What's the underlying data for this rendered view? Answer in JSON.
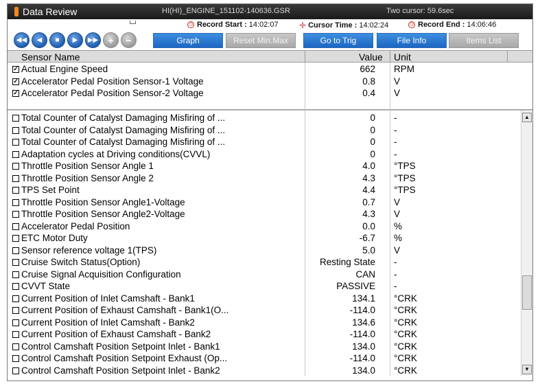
{
  "titlebar": {
    "app_title": "Data Review",
    "file_name": "HI(HI)_ENGINE_151102-140636.GSR",
    "cursor_info": "Two cursor: 59.6sec"
  },
  "timebar": {
    "record_start_label": "Record Start :",
    "record_start": "14:02:07",
    "cursor_time_label": "Cursor Time :",
    "cursor_time": "14:02:24",
    "record_end_label": "Record End :",
    "record_end": "14:06:46"
  },
  "toolbar": {
    "nav": [
      "first-icon",
      "prev-icon",
      "stop-icon",
      "play-icon",
      "last-icon",
      "plus-icon",
      "minus-icon"
    ],
    "buttons": [
      "Graph",
      "Reset Min.Max",
      "Go to Trig",
      "File Info",
      "Items List"
    ]
  },
  "columns": {
    "name": "Sensor Name",
    "value": "Value",
    "unit": "Unit"
  },
  "fixed_rows": [
    {
      "name": "Actual Engine Speed",
      "value": "662",
      "unit": "RPM"
    },
    {
      "name": "Accelerator Pedal Position Sensor-1 Voltage",
      "value": "0.8",
      "unit": "V"
    },
    {
      "name": "Accelerator Pedal Position Sensor-2 Voltage",
      "value": "0.4",
      "unit": "V"
    }
  ],
  "rows": [
    {
      "name": "Total Counter of Catalyst Damaging Misfiring of ...",
      "value": "0",
      "unit": "-"
    },
    {
      "name": "Total Counter of Catalyst Damaging Misfiring of ...",
      "value": "0",
      "unit": "-"
    },
    {
      "name": "Total Counter of Catalyst Damaging Misfiring of ...",
      "value": "0",
      "unit": "-"
    },
    {
      "name": "Adaptation cycles at Driving conditions(CVVL)",
      "value": "0",
      "unit": "-"
    },
    {
      "name": "Throttle Position Sensor Angle 1",
      "value": "4.0",
      "unit": "°TPS"
    },
    {
      "name": "Throttle Position Sensor Angle 2",
      "value": "4.3",
      "unit": "°TPS"
    },
    {
      "name": "TPS Set Point",
      "value": "4.4",
      "unit": "°TPS"
    },
    {
      "name": "Throttle Position Sensor Angle1-Voltage",
      "value": "0.7",
      "unit": "V"
    },
    {
      "name": "Throttle Position Sensor Angle2-Voltage",
      "value": "4.3",
      "unit": "V"
    },
    {
      "name": "Accelerator Pedal Position",
      "value": "0.0",
      "unit": "%"
    },
    {
      "name": "ETC Motor Duty",
      "value": "-6.7",
      "unit": "%"
    },
    {
      "name": "Sensor reference voltage 1(TPS)",
      "value": "5.0",
      "unit": "V"
    },
    {
      "name": "Cruise Switch Status(Option)",
      "value": "Resting State",
      "unit": "-"
    },
    {
      "name": "Cruise Signal Acquisition Configuration",
      "value": "CAN",
      "unit": "-"
    },
    {
      "name": "CVVT State",
      "value": "PASSIVE",
      "unit": "-"
    },
    {
      "name": "Current Position of Inlet Camshaft - Bank1",
      "value": "134.1",
      "unit": "°CRK"
    },
    {
      "name": "Current Position of Exhaust Camshaft - Bank1(O...",
      "value": "-114.0",
      "unit": "°CRK"
    },
    {
      "name": "Current Position of Inlet Camshaft - Bank2",
      "value": "134.6",
      "unit": "°CRK"
    },
    {
      "name": "Current Position of Exhaust Camshaft - Bank2",
      "value": "-114.0",
      "unit": "°CRK"
    },
    {
      "name": "Control Camshaft Position Setpoint Inlet - Bank1",
      "value": "134.0",
      "unit": "°CRK"
    },
    {
      "name": "Control Camshaft Position Setpoint Exhaust (Op...",
      "value": "-114.0",
      "unit": "°CRK"
    },
    {
      "name": "Control Camshaft Position Setpoint Inlet - Bank2",
      "value": "134.0",
      "unit": "°CRK"
    }
  ],
  "colors": {
    "accent": "#1d66c2",
    "title_bg": "#222222",
    "header_bg": "#dcdcdc",
    "app_icon": "#f08a1c"
  }
}
